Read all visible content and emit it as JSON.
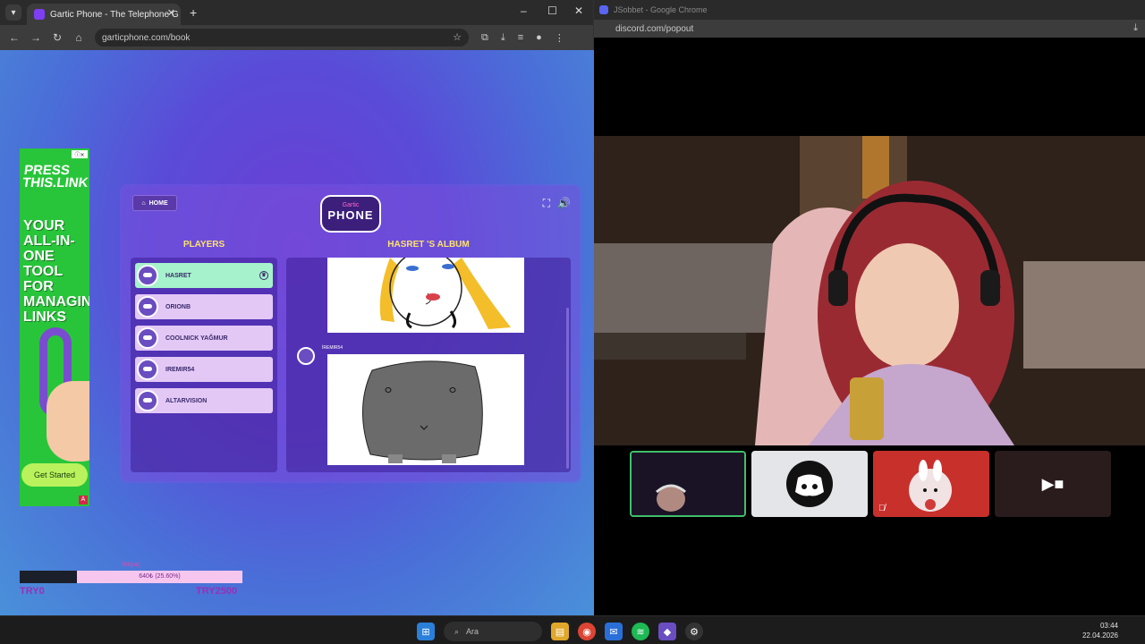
{
  "browser_left": {
    "tab_title": "Gartic Phone - The Telephone G",
    "url": "garticphone.com/book",
    "new_tab": "+",
    "controls": {
      "minimize": "–",
      "maximize": "☐",
      "close": "✕"
    }
  },
  "ad": {
    "press": "PRESS THIS.LINK",
    "headline": "YOUR ALL-IN-ONE TOOL FOR MANAGING LINKS",
    "cta": "Get Started",
    "ad_mark": "A"
  },
  "game": {
    "home_label": "HOME",
    "logo_top": "Gartic",
    "logo_main": "PHONE",
    "players_heading": "PLAYERS",
    "album_heading": "HASRET 'S ALBUM",
    "players": [
      {
        "name": "HASRET",
        "active": true
      },
      {
        "name": "ORIONB",
        "active": false
      },
      {
        "name": "COOLNICK YAĞMUR",
        "active": false
      },
      {
        "name": "IREMIR54",
        "active": false
      },
      {
        "name": "ALTARVISION",
        "active": false
      }
    ],
    "album_author": "İREMIR54"
  },
  "donation": {
    "label": "İhtiyaç",
    "progress_text": "640₺ (25.60%)",
    "progress": 0.256,
    "min_label": "TRY0",
    "max_label": "TRY2500"
  },
  "browser_right": {
    "title": "JSobbet - Google Chrome",
    "url": "discord.com/popout"
  },
  "taskbar": {
    "search_placeholder": "Ara",
    "time": "03:44",
    "date": "22.04.2026"
  },
  "colors": {
    "accent_players": "#ffe26a",
    "active_player": "#a6f2cd",
    "player": "#e3c8f6",
    "progress_fill": "#1b1f2a",
    "progress_bg": "#f6c6ee"
  }
}
